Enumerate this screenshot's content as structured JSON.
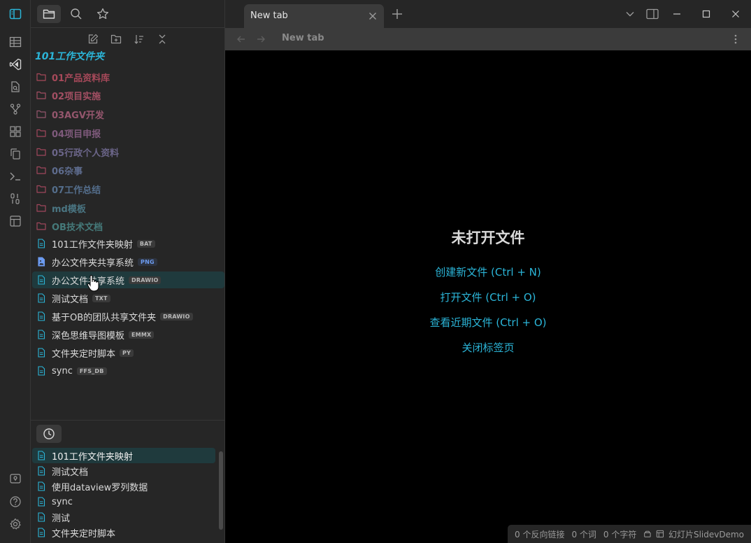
{
  "colors": {
    "accent": "#2bb5d8",
    "background": "#000000",
    "panel": "#262626"
  },
  "ribbon": {
    "icons": [
      "sidebar-toggle-icon",
      "table-icon",
      "vscode-icon",
      "file-search-icon",
      "git-graph-icon",
      "apps-icon",
      "copy-icon",
      "terminal-icon",
      "binary-icon",
      "layout-icon",
      "help-bubble-icon",
      "help-icon",
      "settings-icon"
    ]
  },
  "sidebar": {
    "tabs": [
      "files-icon",
      "search-icon",
      "bookmark-icon"
    ],
    "nav_actions": [
      "new-note-icon",
      "new-folder-icon",
      "sort-icon",
      "collapse-all-icon"
    ],
    "vault_name": "101工作文件夹",
    "folders": [
      {
        "label": "01产品资料库",
        "color": "#a7495a"
      },
      {
        "label": "02项目实施",
        "color": "#a34f63"
      },
      {
        "label": "03AGV开发",
        "color": "#95566d"
      },
      {
        "label": "04项目申报",
        "color": "#7f5a7c"
      },
      {
        "label": "05行政个人资料",
        "color": "#6b6589"
      },
      {
        "label": "06杂事",
        "color": "#5e6c8e"
      },
      {
        "label": "07工作总结",
        "color": "#546e8c"
      },
      {
        "label": "md模板",
        "color": "#4a7582"
      },
      {
        "label": "OB技术文档",
        "color": "#457a7a"
      }
    ],
    "files": [
      {
        "label": "101工作文件夹映射",
        "tag": "BAT"
      },
      {
        "label": "办公文件夹共享系统",
        "tag": "PNG"
      },
      {
        "label": "办公文件共享系统",
        "tag": "DRAWIO"
      },
      {
        "label": "测试文档",
        "tag": "TXT"
      },
      {
        "label": "基于OB的团队共享文件夹",
        "tag": "DRAWIO"
      },
      {
        "label": "深色思维导图模板",
        "tag": "EMMX"
      },
      {
        "label": "文件夹定时脚本",
        "tag": "PY"
      },
      {
        "label": "sync",
        "tag": "FFS_DB"
      }
    ],
    "recent": {
      "icon": "clock-icon",
      "items": [
        "101工作文件夹映射",
        "测试文档",
        "使用dataview罗列数据",
        "sync",
        "测试",
        "文件夹定时脚本"
      ]
    }
  },
  "tabbar": {
    "tab_title": "New tab"
  },
  "view": {
    "title": "New tab",
    "empty_state": {
      "heading": "未打开文件",
      "actions": [
        "创建新文件 (Ctrl + N)",
        "打开文件 (Ctrl + O)",
        "查看近期文件 (Ctrl + O)",
        "关闭标签页"
      ]
    }
  },
  "statusbar": {
    "backlinks": "0 个反向链接",
    "words": "0 个词",
    "chars": "0 个字符",
    "slides": "幻灯片SlidevDemo"
  }
}
